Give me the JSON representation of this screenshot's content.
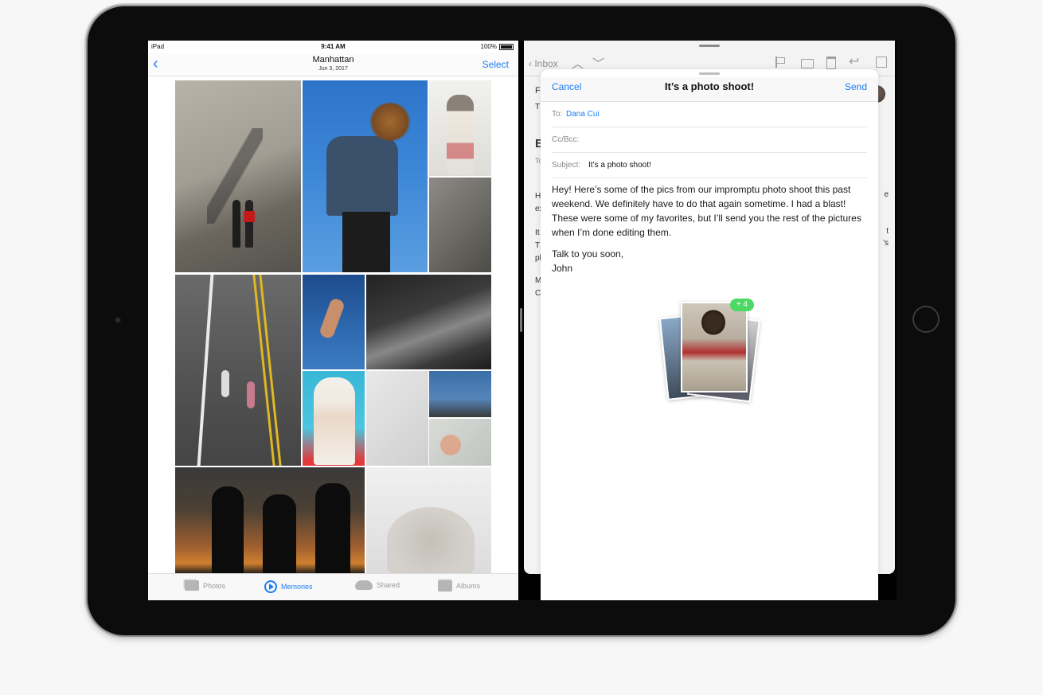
{
  "status_bar": {
    "device": "iPad",
    "time": "9:41 AM",
    "battery": "100%"
  },
  "photos": {
    "nav": {
      "title": "Manhattan",
      "subtitle": "Jun 3, 2017",
      "select_label": "Select"
    },
    "tabs": [
      {
        "label": "Photos",
        "active": false,
        "icon": "photos-icon"
      },
      {
        "label": "Memories",
        "active": true,
        "icon": "memories-icon"
      },
      {
        "label": "Shared",
        "active": false,
        "icon": "cloud-icon"
      },
      {
        "label": "Albums",
        "active": false,
        "icon": "albums-icon"
      }
    ]
  },
  "mail": {
    "toolbar": {
      "back_label": "Inbox",
      "prev": "︿",
      "next": "﹀"
    },
    "background_fragments": {
      "from_initial": "F",
      "to_initial": "T",
      "subject_initial": "B",
      "subject_sub": "To",
      "body1": "H",
      "body1b": "ex",
      "body2": "It",
      "body2b": "T",
      "body2c": "pl",
      "body3": "M",
      "body3b": "C",
      "right1": "e",
      "right2": "t",
      "right3": "’s"
    },
    "compose": {
      "cancel_label": "Cancel",
      "title": "It’s a photo shoot!",
      "send_label": "Send",
      "to_label": "To:",
      "to_value": "Dana Cui",
      "cc_label": "Cc/Bcc:",
      "subject_label": "Subject:",
      "subject_value": "It’s a photo shoot!",
      "body_paragraph": "Hey! Here’s some of the pics from our impromptu photo shoot this past weekend. We definitely have to do that again sometime. I had a blast! These were some of my favorites, but I’ll send you the rest of the pictures when I’m done editing them.",
      "sign_off_line1": "Talk to you soon,",
      "sign_off_line2": "John",
      "attachment_badge": "+ 4"
    }
  },
  "colors": {
    "accent": "#1a7cf5",
    "badge": "#4cd964",
    "bezel": "#0c0c0c"
  }
}
